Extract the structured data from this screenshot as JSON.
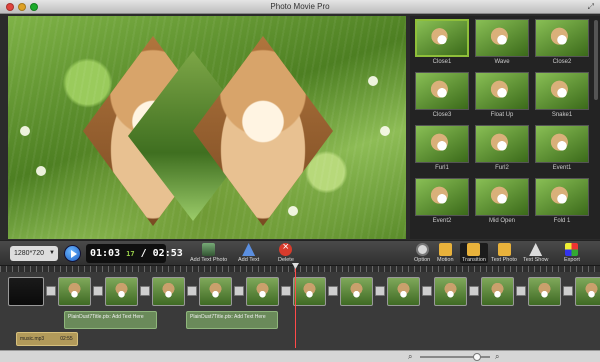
{
  "window": {
    "title": "Photo Movie Pro"
  },
  "preview": {
    "description_icon": "photo-preview"
  },
  "transitions": [
    {
      "label": "Close1"
    },
    {
      "label": "Wave"
    },
    {
      "label": "Close2"
    },
    {
      "label": "Close3"
    },
    {
      "label": "Float Up"
    },
    {
      "label": "Snake1"
    },
    {
      "label": "Furl1"
    },
    {
      "label": "Furl2"
    },
    {
      "label": "Event1"
    },
    {
      "label": "Event2"
    },
    {
      "label": "Mid Open"
    },
    {
      "label": "Fold 1"
    }
  ],
  "toolbar": {
    "resolution": "1280*720",
    "time_current": "01:03",
    "time_frame": "17",
    "time_total": "/ 02:53",
    "add_photo_label": "Add Text Photo",
    "add_text_label": "Add Text",
    "delete_label": "Delete",
    "option_label": "Option",
    "motion_label": "Motion",
    "transition_label": "Transition",
    "text_photo_label": "Text Photo",
    "text_show_label": "Text Show",
    "export_label": "Export"
  },
  "timeline": {
    "text_clips": [
      {
        "label": "PlainDust7Title.ptx: Add Text Here"
      },
      {
        "label": "PlainDust7Title.ptx: Add Text Here"
      }
    ],
    "music": {
      "name": "music.mp3",
      "duration": "02:55"
    },
    "zoom_level": 0.85
  },
  "colors": {
    "accent": "#8fbf3a",
    "playhead": "#ff4a4a",
    "play_button": "#1d5fc4"
  }
}
